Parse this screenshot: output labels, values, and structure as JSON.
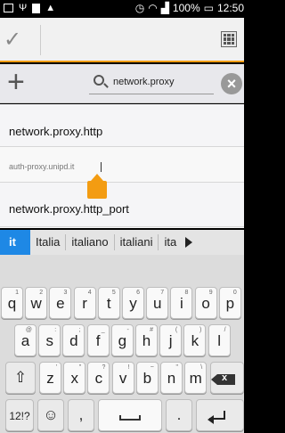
{
  "status_bar": {
    "battery_percent": "100%",
    "time": "12:50",
    "icons": [
      "image-icon",
      "usb-icon",
      "square-icon",
      "android-icon",
      "alarm-icon",
      "wifi-icon",
      "signal-icon",
      "battery-icon"
    ]
  },
  "action_bar": {
    "confirm_icon": "check-icon",
    "menu_icon": "grid-icon",
    "accent_color": "#f39c12"
  },
  "search": {
    "add_icon": "plus-icon",
    "value": "network.proxy",
    "clear_icon": "clear-icon"
  },
  "list": {
    "items": [
      {
        "label": "network.proxy.http"
      },
      {
        "value": "auth-proxy.unipd.it"
      },
      {
        "label": "network.proxy.http_port"
      }
    ]
  },
  "suggestions": {
    "items": [
      "it",
      "Italia",
      "italiano",
      "italiani",
      "ita"
    ],
    "highlight_color": "#1e88e5"
  },
  "keyboard": {
    "row1": [
      {
        "key": "q",
        "sup": "1"
      },
      {
        "key": "w",
        "sup": "2"
      },
      {
        "key": "e",
        "sup": "3"
      },
      {
        "key": "r",
        "sup": "4"
      },
      {
        "key": "t",
        "sup": "5"
      },
      {
        "key": "y",
        "sup": "6"
      },
      {
        "key": "u",
        "sup": "7"
      },
      {
        "key": "i",
        "sup": "8"
      },
      {
        "key": "o",
        "sup": "9"
      },
      {
        "key": "p",
        "sup": "0"
      }
    ],
    "row2": [
      {
        "key": "a",
        "sup": "@"
      },
      {
        "key": "s",
        "sup": ":"
      },
      {
        "key": "d",
        "sup": ";"
      },
      {
        "key": "f",
        "sup": "_"
      },
      {
        "key": "g",
        "sup": "-"
      },
      {
        "key": "h",
        "sup": "#"
      },
      {
        "key": "j",
        "sup": "("
      },
      {
        "key": "k",
        "sup": ")"
      },
      {
        "key": "l",
        "sup": "/"
      }
    ],
    "row3": [
      {
        "key": "z",
        "sup": "'"
      },
      {
        "key": "x",
        "sup": "\""
      },
      {
        "key": "c",
        "sup": "?"
      },
      {
        "key": "v",
        "sup": "!"
      },
      {
        "key": "b",
        "sup": "~"
      },
      {
        "key": "n",
        "sup": "\""
      },
      {
        "key": "m",
        "sup": "\\"
      }
    ],
    "shift_label": "⇧",
    "symbols_label": "12!?",
    "emoji_label": "☺",
    "comma_label": ",",
    "period_label": "."
  }
}
